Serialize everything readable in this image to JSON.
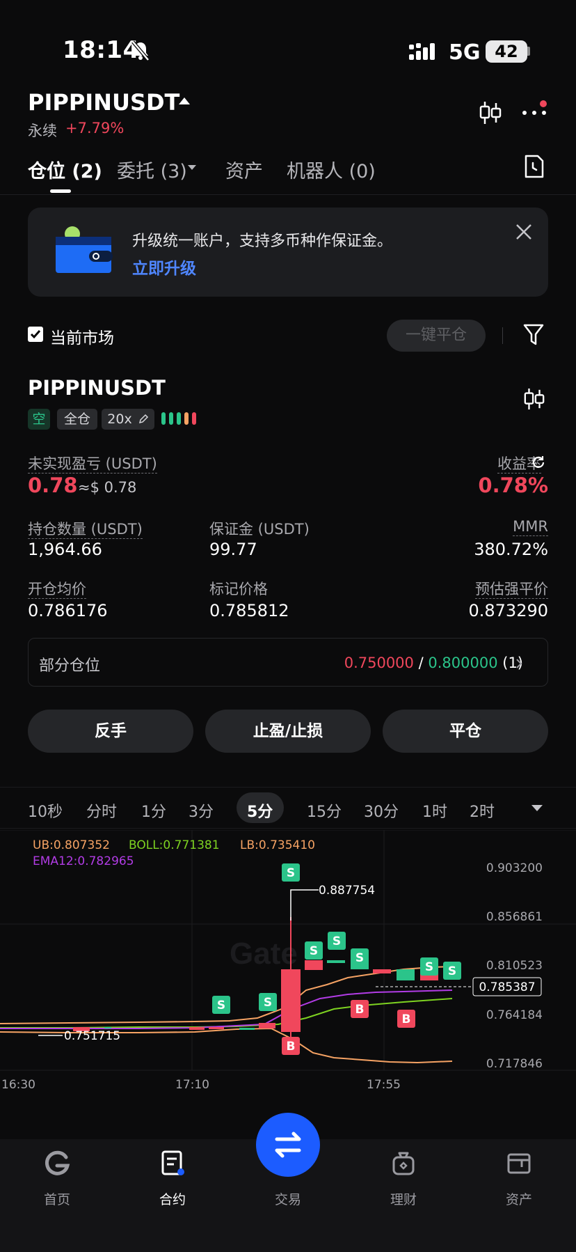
{
  "status_bar": {
    "time": "18:14",
    "network": "5G",
    "battery": "42"
  },
  "header": {
    "symbol": "PIPPINUSDT",
    "contract_type": "永续",
    "change": "+7.79%"
  },
  "tabs": [
    {
      "label": "仓位 (2)"
    },
    {
      "label": "委托 (3)"
    },
    {
      "label": "资产"
    },
    {
      "label": "机器人 (0)"
    }
  ],
  "banner": {
    "text": "升级统一账户，支持多币种作保证金。",
    "link": "立即升级"
  },
  "market_filter": {
    "label": "当前市场",
    "close_all": "一键平仓"
  },
  "position": {
    "symbol": "PIPPINUSDT",
    "side": "空",
    "margin_mode": "全仓",
    "leverage": "20x",
    "unrealized_pnl_label": "未实现盈亏 (USDT)",
    "unrealized_pnl": "0.78",
    "unrealized_pnl_approx": "≈$ 0.78",
    "roe_label": "收益率",
    "roe": "0.78%",
    "size_label": "持仓数量 (USDT)",
    "size": "1,964.66",
    "margin_label": "保证金 (USDT)",
    "margin": "99.77",
    "mmr_label": "MMR",
    "mmr": "380.72%",
    "entry_label": "开仓均价",
    "entry": "0.786176",
    "mark_label": "标记价格",
    "mark": "0.785812",
    "liq_label": "预估强平价",
    "liq": "0.873290",
    "partial_label": "部分仓位",
    "partial_tp": "0.750000",
    "partial_sep": "/",
    "partial_sl": "0.800000",
    "partial_count": "(1)"
  },
  "actions": {
    "reverse": "反手",
    "tpsl": "止盈/止损",
    "close": "平仓"
  },
  "timeframes": [
    "10秒",
    "分时",
    "1分",
    "3分",
    "5分",
    "15分",
    "30分",
    "1时",
    "2时"
  ],
  "active_timeframe": "5分",
  "chart_data": {
    "type": "candlestick",
    "indicators": {
      "ub": "UB:0.807352",
      "boll": "BOLL:0.771381",
      "lb": "LB:0.735410",
      "ema": "EMA12:0.782965"
    },
    "y_ticks": [
      "0.903200",
      "0.856861",
      "0.810523",
      "0.764184",
      "0.717846"
    ],
    "x_ticks": [
      "16:30",
      "17:10",
      "17:55"
    ],
    "high_label": "0.887754",
    "low_label": "0.751715",
    "current_price": "0.785387",
    "marker_sell": "S",
    "marker_buy": "B",
    "colors": {
      "up": "#2bc48a",
      "down": "#f0475c",
      "ub": "#f6a364",
      "boll": "#7ed321",
      "lb": "#f6a364",
      "ema": "#b23ce6"
    }
  },
  "nav": [
    {
      "label": "首页",
      "icon": "home-icon"
    },
    {
      "label": "合约",
      "icon": "contract-icon"
    },
    {
      "label": "交易",
      "icon": "swap-icon"
    },
    {
      "label": "理财",
      "icon": "finance-icon"
    },
    {
      "label": "资产",
      "icon": "wallet-icon"
    }
  ]
}
